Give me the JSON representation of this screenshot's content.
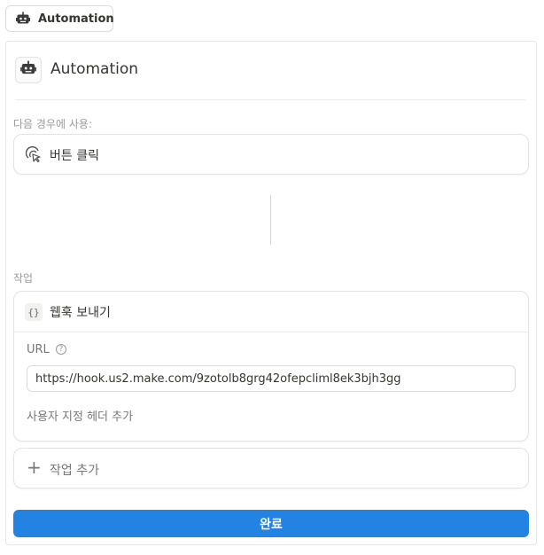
{
  "tag": {
    "label": "Automation",
    "icon": "robot-icon"
  },
  "header": {
    "title": "Automation",
    "icon": "robot-icon"
  },
  "trigger": {
    "section_label": "다음 경우에 사용:",
    "label": "버튼 클릭",
    "icon": "cursor-click-icon"
  },
  "action": {
    "section_label": "작업",
    "title": "웹훅 보내기",
    "icon_glyph": "{}",
    "url_label": "URL",
    "url_value": "https://hook.us2.make.com/9zotolb8grg42ofepcliml8ek3bjh3gg",
    "custom_header_label": "사용자 지정 헤더 추가"
  },
  "add_action": {
    "label": "작업 추가"
  },
  "done_button": {
    "label": "완료"
  },
  "colors": {
    "accent": "#2383e2",
    "text": "#37352f",
    "muted": "#9b9a97"
  }
}
